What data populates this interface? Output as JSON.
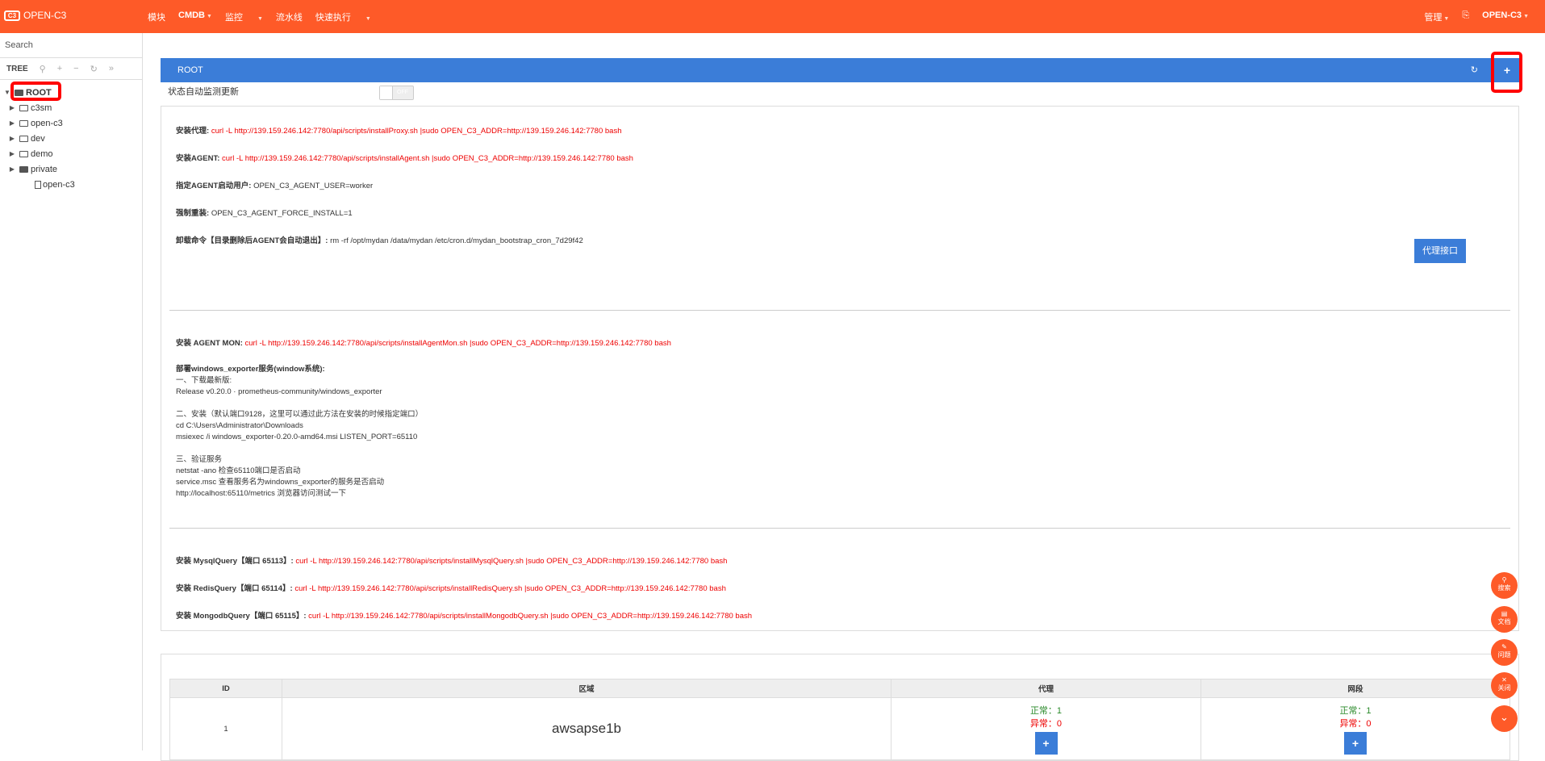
{
  "header": {
    "logo_text": "OPEN-C3",
    "logo_mark": "C3",
    "nav": [
      "模块",
      "CMDB",
      "监控",
      "流水线",
      "快速执行"
    ],
    "right": [
      "管理",
      "OPEN-C3"
    ]
  },
  "sidebar": {
    "search_placeholder": "Search",
    "tree_label": "TREE",
    "root": "ROOT",
    "nodes": [
      "c3sm",
      "open-c3",
      "dev",
      "demo",
      "private"
    ],
    "leaf": "open-c3"
  },
  "main": {
    "bar_title": "ROOT",
    "add_label": "+",
    "status_label": "状态自动监测更新",
    "toggle_label": "OFF",
    "install_proxy_label": "安装代理:",
    "install_proxy_cmd": "curl -L http://139.159.246.142:7780/api/scripts/installProxy.sh |sudo OPEN_C3_ADDR=http://139.159.246.142:7780 bash",
    "install_agent_label": "安装AGENT:",
    "install_agent_cmd": "curl -L http://139.159.246.142:7780/api/scripts/installAgent.sh |sudo OPEN_C3_ADDR=http://139.159.246.142:7780 bash",
    "agent_user_label": "指定AGENT启动用户:",
    "agent_user_val": "OPEN_C3_AGENT_USER=worker",
    "force_label": "强制重装:",
    "force_val": "OPEN_C3_AGENT_FORCE_INSTALL=1",
    "uninstall_label": "卸载命令【目录删除后AGENT会自动退出】:",
    "uninstall_val": "rm -rf /opt/mydan /data/mydan /etc/cron.d/mydan_bootstrap_cron_7d29f42",
    "proxy_btn": "代理接口",
    "agentmon_label": "安装 AGENT MON:",
    "agentmon_cmd": "curl -L http://139.159.246.142:7780/api/scripts/installAgentMon.sh |sudo OPEN_C3_ADDR=http://139.159.246.142:7780 bash",
    "win_title": "部署windows_exporter服务(window系统):",
    "win_lines": [
      "一、下载最新版:",
      "Release v0.20.0 · prometheus-community/windows_exporter",
      "",
      "二、安装（默认端口9128，这里可以通过此方法在安装的时候指定端口）",
      "cd C:\\Users\\Administrator\\Downloads",
      "msiexec /i windows_exporter-0.20.0-amd64.msi LISTEN_PORT=65110",
      "",
      "三、验证服务",
      "netstat -ano 检查65110端口是否启动",
      "service.msc 查看服务名为windowns_exporter的服务是否启动",
      "http://localhost:65110/metrics 浏览器访问测试一下"
    ],
    "mysql_label": "安装 MysqlQuery【端口 65113】:",
    "mysql_cmd": "curl -L http://139.159.246.142:7780/api/scripts/installMysqlQuery.sh |sudo OPEN_C3_ADDR=http://139.159.246.142:7780 bash",
    "redis_label": "安装 RedisQuery【端口 65114】:",
    "redis_cmd": "curl -L http://139.159.246.142:7780/api/scripts/installRedisQuery.sh |sudo OPEN_C3_ADDR=http://139.159.246.142:7780 bash",
    "mongo_label": "安装 MongodbQuery【端口 65115】:",
    "mongo_cmd": "curl -L http://139.159.246.142:7780/api/scripts/installMongodbQuery.sh |sudo OPEN_C3_ADDR=http://139.159.246.142:7780 bash"
  },
  "table": {
    "headers": [
      "ID",
      "区域",
      "代理",
      "网段"
    ],
    "row": {
      "id": "1",
      "region": "awsapse1b",
      "proxy_ok": "正常：1",
      "proxy_bad": "异常：0",
      "net_ok": "正常：1",
      "net_bad": "异常：0"
    }
  },
  "fabs": [
    "搜索",
    "文档",
    "问题",
    "关闭"
  ]
}
